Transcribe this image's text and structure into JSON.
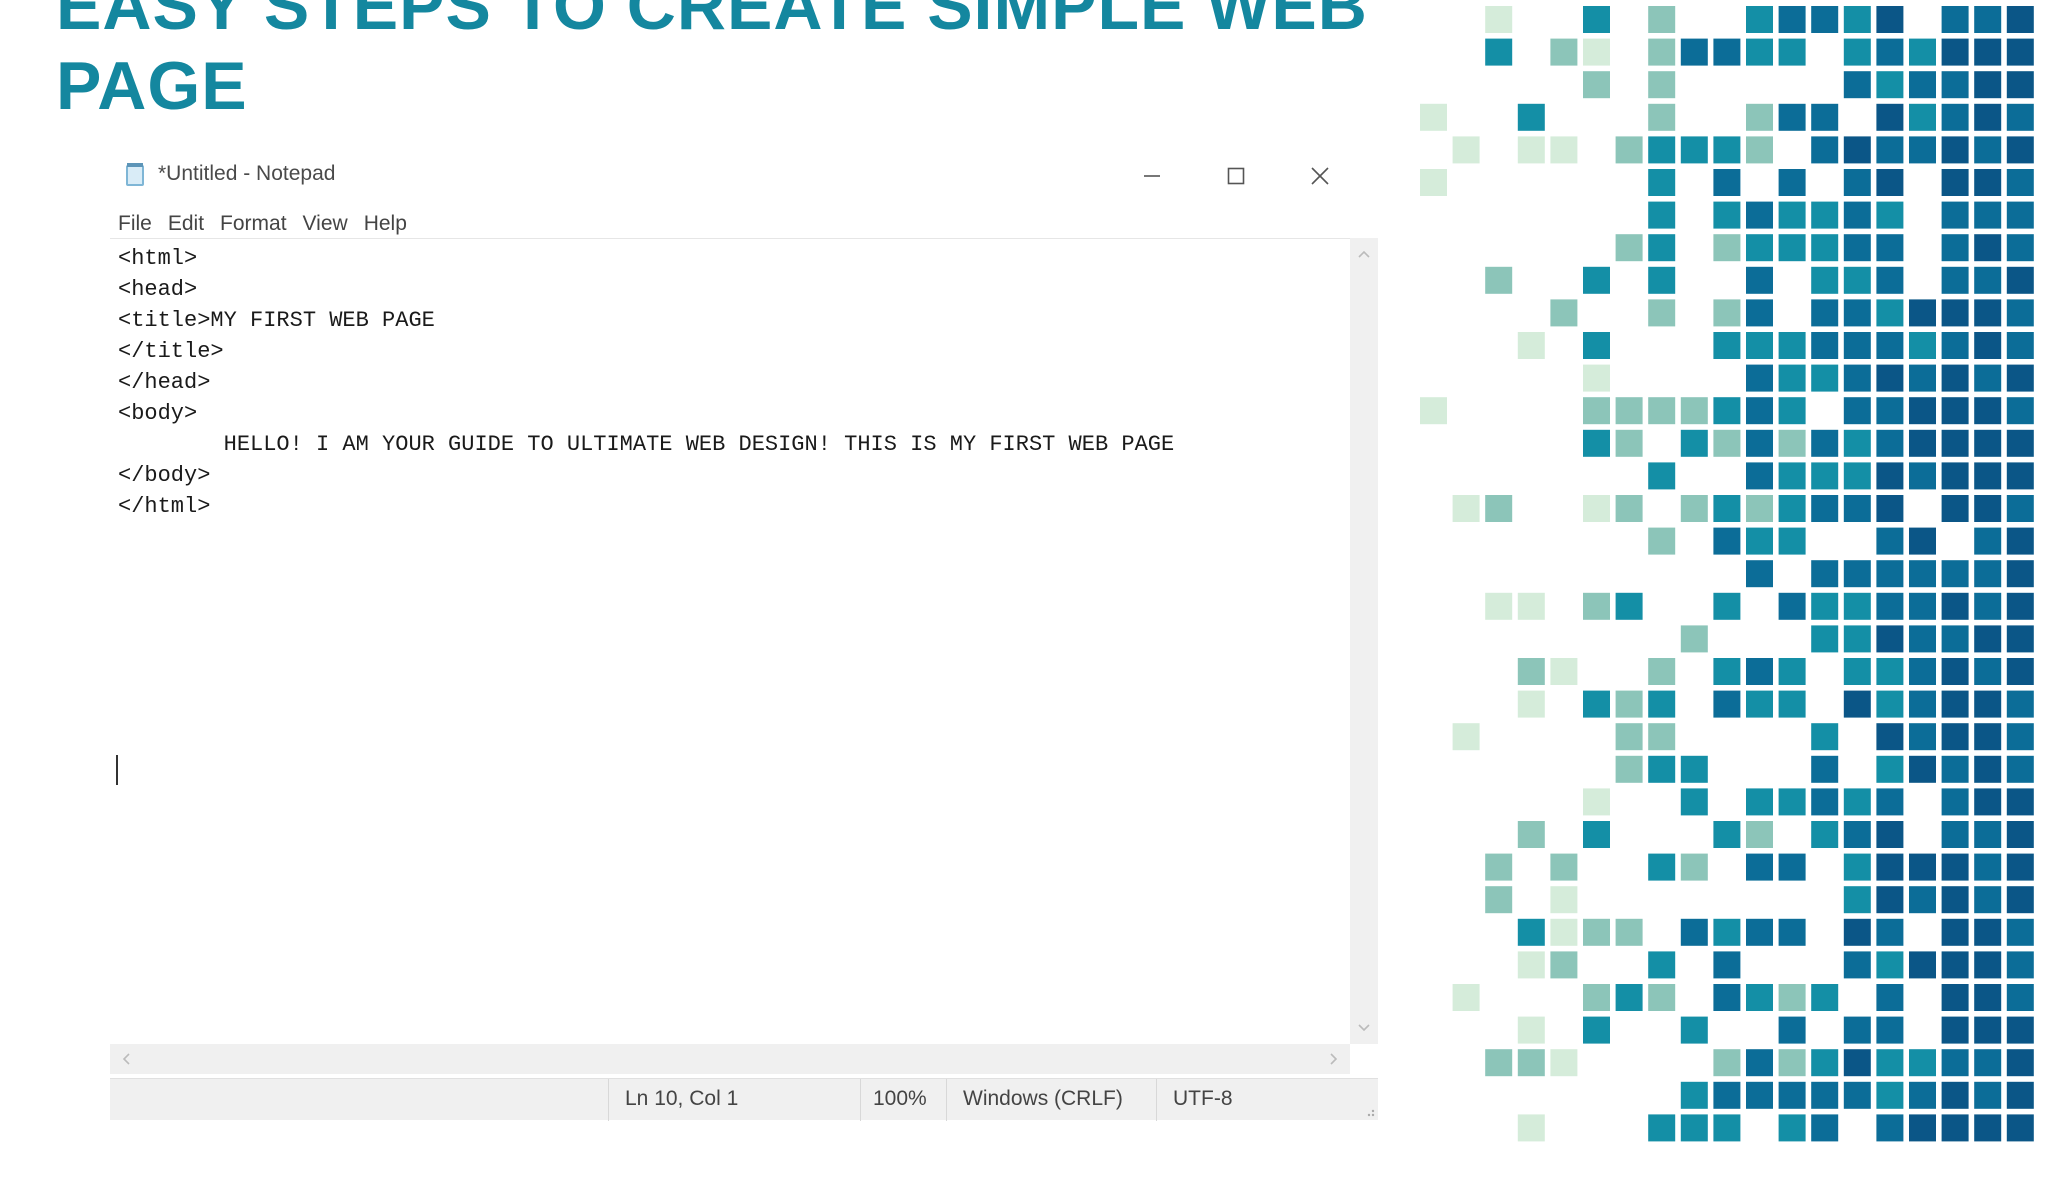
{
  "slide": {
    "title": "EASY STEPS TO CREATE SIMPLE WEB PAGE"
  },
  "colors": {
    "title": "#14879f",
    "mosaic": [
      "#d5ecda",
      "#8cc5b9",
      "#148fa6",
      "#0c6d98",
      "#0b5687"
    ]
  },
  "notepad": {
    "window_title": "*Untitled - Notepad",
    "icons": {
      "app": "notepad-icon",
      "minimize": "minimize-icon",
      "maximize": "maximize-icon",
      "close": "close-icon"
    },
    "menu": [
      "File",
      "Edit",
      "Format",
      "View",
      "Help"
    ],
    "content": "<html>\n<head>\n<title>MY FIRST WEB PAGE\n</title>\n</head>\n<body>\n        HELLO! I AM YOUR GUIDE TO ULTIMATE WEB DESIGN! THIS IS MY FIRST WEB PAGE\n</body>\n</html>",
    "status": {
      "position": "Ln 10, Col 1",
      "zoom": "100%",
      "line_ending": "Windows (CRLF)",
      "encoding": "UTF-8"
    }
  }
}
